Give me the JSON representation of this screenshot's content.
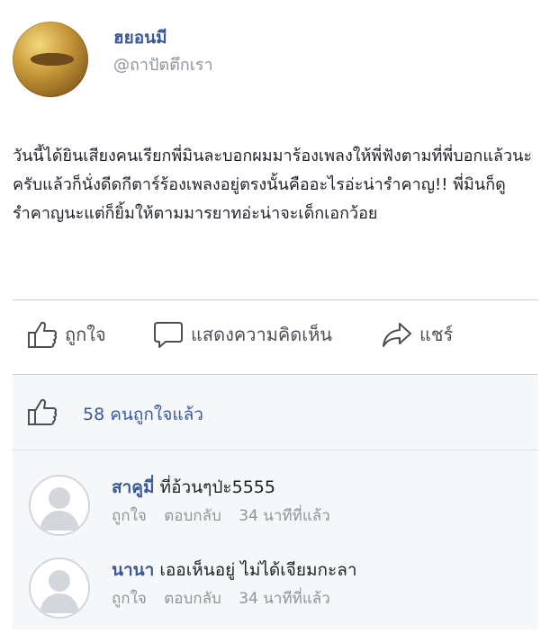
{
  "post": {
    "author_name": "ฮยอนมี",
    "author_handle": "@ถาปัตตึกเรา",
    "text": "วันนี้ได้ยินเสียงคนเรียกพี่มินละบอกผมมาร้องเพลงให้พี่ฟังตามที่พี่บอกแล้วนะครับแล้วก็นั่งดีดกีตาร์ร้องเพลงอยู่ตรงนั้นคืออะไรอ่ะน่ารำคาญ!! พี่มินก็ดูรำคาญนะแต่ก็ยิ้มให้ตามมารยาทอ่ะน่าจะเด็กเอกว้อย"
  },
  "actions": {
    "like": "ถูกใจ",
    "comment": "แสดงความคิดเห็น",
    "share": "แชร์"
  },
  "likes": {
    "count_text": "58 คนถูกใจแล้ว"
  },
  "comments": [
    {
      "name": "สาคูมี่",
      "text": "ที่อ้วนๆป่ะ5555",
      "like": "ถูกใจ",
      "reply": "ตอบกลับ",
      "time": "34 นาทีที่แล้ว"
    },
    {
      "name": "นานา",
      "text": "เออเห็นอยู่ ไม่ได้เจียมกะลา",
      "like": "ถูกใจ",
      "reply": "ตอบกลับ",
      "time": "34 นาทีที่แล้ว"
    }
  ],
  "colors": {
    "link_blue": "#3b5998",
    "meta_gray": "#90949c",
    "panel_bg": "#f6f7f9"
  },
  "icons": [
    "thumbs-up-icon",
    "speech-bubble-icon",
    "share-arrow-icon",
    "default-avatar-icon"
  ]
}
